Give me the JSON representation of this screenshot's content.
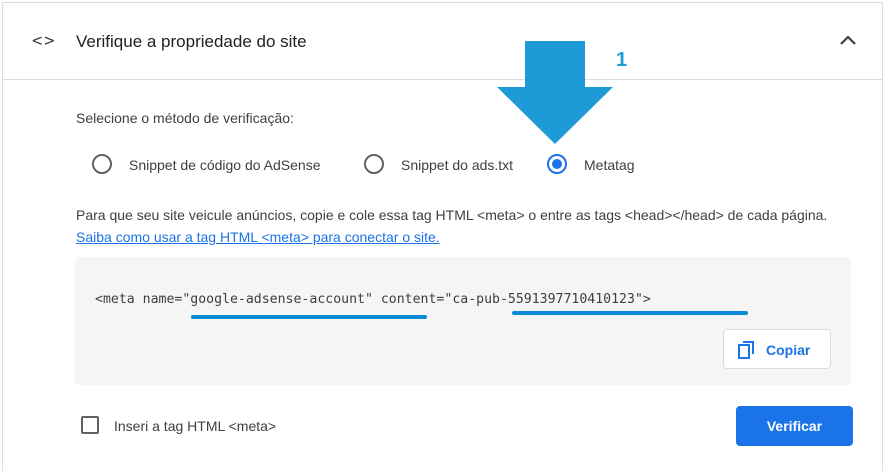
{
  "header": {
    "code_icon": "code-brackets-icon",
    "title": "Verifique a propriedade do site",
    "collapse_icon": "chevron-up-icon"
  },
  "verification": {
    "label": "Selecione o método de verificação:",
    "options": [
      {
        "label": "Snippet de código do AdSense",
        "selected": false
      },
      {
        "label": "Snippet do ads.txt",
        "selected": false
      },
      {
        "label": "Metatag",
        "selected": true
      }
    ]
  },
  "description": {
    "text": "Para que seu site veicule anúncios, copie e cole essa tag HTML <meta> o entre as tags <head></head> de cada página.",
    "link": "Saiba como usar a tag HTML <meta> para conectar o site."
  },
  "code": {
    "part1": "<meta name=",
    "name_value": "\"google-adsense-account\"",
    "part2": " content=",
    "content_value": "\"ca-pub-5591397710410123\"",
    "part3": ">"
  },
  "copy_button": {
    "label": "Copiar",
    "icon": "copy-icon"
  },
  "checkbox": {
    "label": "Inseri a tag HTML <meta>",
    "checked": false
  },
  "verify_button": {
    "label": "Verificar"
  },
  "annotation": {
    "step": "1",
    "color": "#1e9ad6"
  },
  "colors": {
    "accent": "#1a73e8",
    "annotation": "#0a8bd8"
  }
}
